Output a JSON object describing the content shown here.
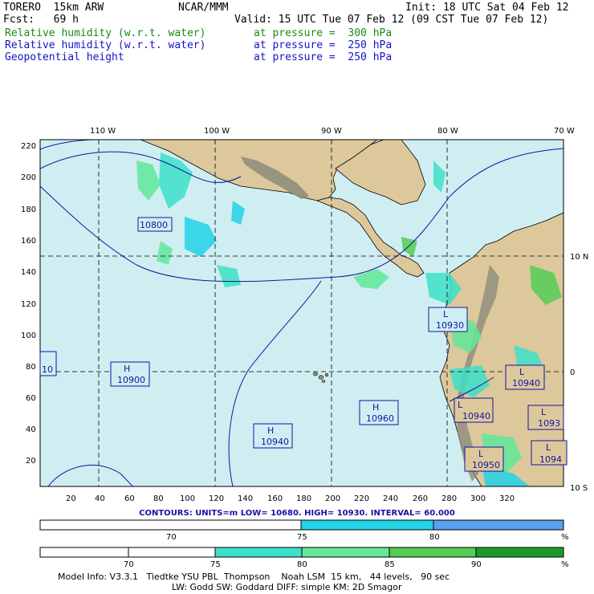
{
  "header": {
    "model": "TORERO  15km ARW",
    "org": "NCAR/MMM",
    "init": "Init: 18 UTC Sat 04 Feb 12",
    "fcst": "Fcst:   69 h",
    "valid": "Valid: 15 UTC Tue 07 Feb 12 (09 CST Tue 07 Feb 12)",
    "fields": [
      {
        "name": "Relative humidity (w.r.t. water)",
        "level": "at pressure =  300 hPa",
        "color": "#1a8a1a"
      },
      {
        "name": "Relative humidity (w.r.t. water)",
        "level": "at pressure =  250 hPa",
        "color": "#1414c8"
      },
      {
        "name": "Geopotential height",
        "level": "at pressure =  250 hPa",
        "color": "#1414c8"
      }
    ]
  },
  "map": {
    "lon_labels": [
      "110 W",
      "100 W",
      "90 W",
      "80 W",
      "70 W"
    ],
    "lat_labels": [
      "10 N",
      "0",
      "10 S"
    ],
    "y_ticks": [
      "220",
      "200",
      "180",
      "160",
      "140",
      "120",
      "100",
      "80",
      "60",
      "40",
      "20"
    ],
    "x_ticks": [
      "20",
      "40",
      "60",
      "80",
      "100",
      "120",
      "140",
      "160",
      "180",
      "200",
      "220",
      "240",
      "260",
      "280",
      "300",
      "320"
    ],
    "centers": [
      {
        "kind": "",
        "value": "10800"
      },
      {
        "kind": "H",
        "value": "10900"
      },
      {
        "kind": "L",
        "value": "10930"
      },
      {
        "kind": "L",
        "value": "10940"
      },
      {
        "kind": "H",
        "value": "10960"
      },
      {
        "kind": "L",
        "value": "10940"
      },
      {
        "kind": "H",
        "value": "10940"
      },
      {
        "kind": "L",
        "value": "10950"
      },
      {
        "kind": "L",
        "value": "1094"
      },
      {
        "kind": "L",
        "value": "1093"
      },
      {
        "kind": "",
        "value": "10"
      }
    ],
    "colors": {
      "land": "#ddc89c",
      "ocean": "#cfeef2",
      "mountain": "#8c8c7a"
    }
  },
  "contours": {
    "text": "CONTOURS:  UNITS=m  LOW=  10680.      HIGH=  10930.      INTERVAL=   60.000"
  },
  "colorbar_250": {
    "labels": [
      "70",
      "75",
      "80",
      "%"
    ],
    "colors": [
      "#ffffff",
      "#22d3e8",
      "#5aa0ee"
    ]
  },
  "colorbar_300": {
    "labels": [
      "70",
      "75",
      "80",
      "85",
      "90",
      "%"
    ],
    "colors": [
      "#ffffff",
      "#ffffff",
      "#3de0c8",
      "#62e89a",
      "#55cc55",
      "#1f9a2a"
    ]
  },
  "footer": {
    "line1": "Model Info: V3.3.1   Tiedtke YSU PBL  Thompson    Noah LSM  15 km,   44 levels,   90 sec",
    "line2": "LW: Godd SW: Goddard DIFF: simple KM: 2D Smagor"
  }
}
